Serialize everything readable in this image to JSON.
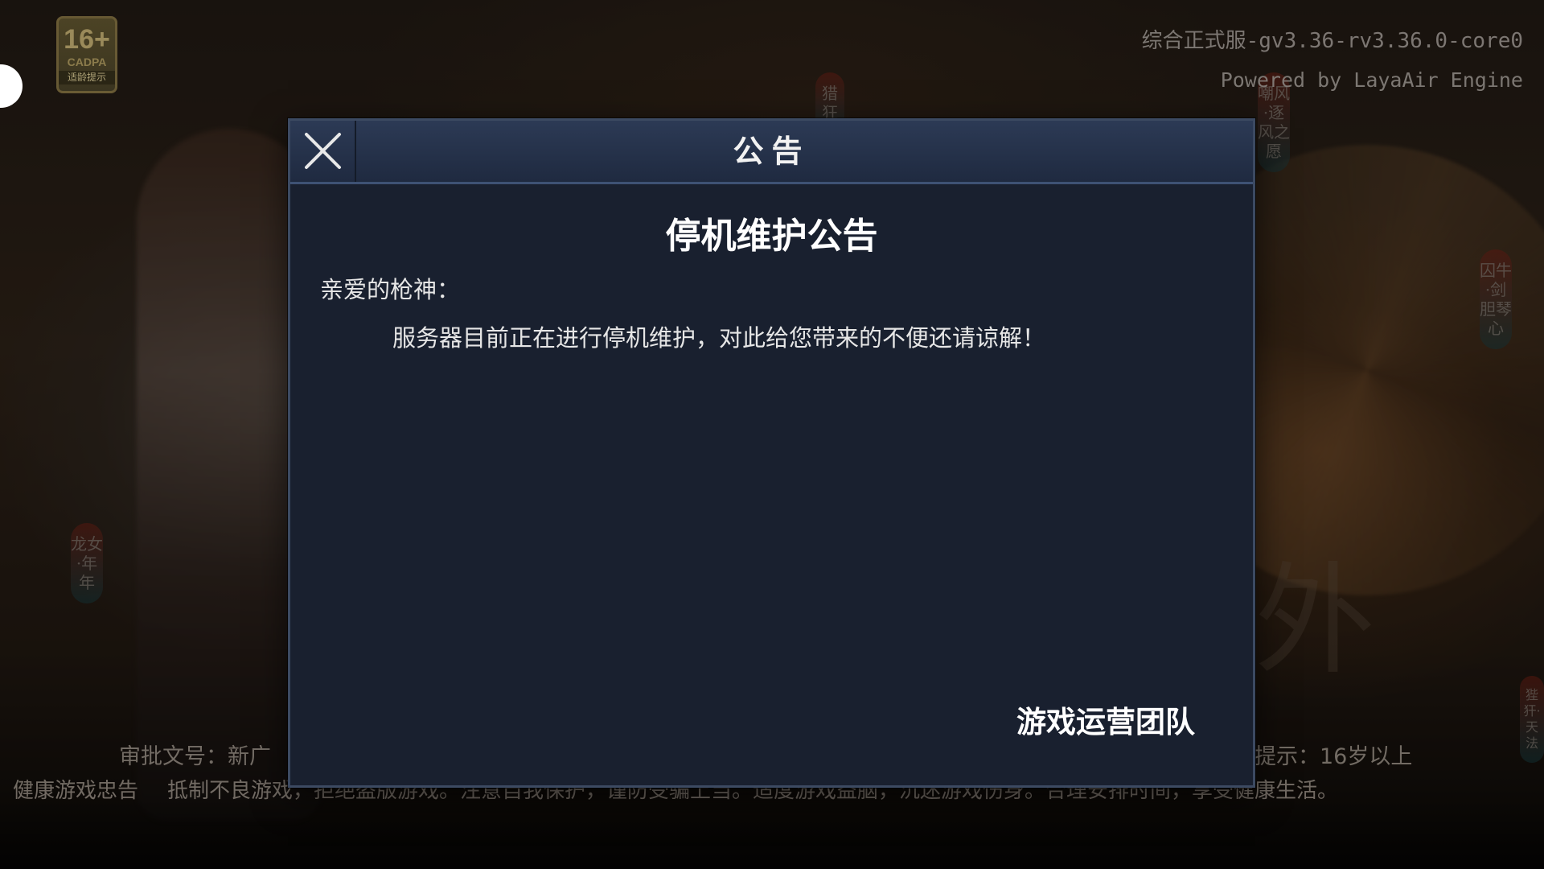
{
  "age_rating": {
    "age": "16+",
    "org": "CADPA",
    "tip": "适龄提示"
  },
  "version": {
    "build": "综合正式服-gv3.36-rv3.36.0-core0",
    "engine": "Powered by LayaAir Engine"
  },
  "banners": {
    "left": "龙女·年年",
    "top_center": "猎狂",
    "right_top": "嘲风·逐风之愿",
    "right_mid": "囚牛·剑胆琴心",
    "right_bottom": "狴犴·天法"
  },
  "footer": {
    "approval": "审批文号：新广",
    "age_hint": "提示：16岁以上",
    "advice_title": "健康游戏忠告",
    "advice_text": "抵制不良游戏，拒绝盗版游戏。注意自我保护，谨防受骗上当。适度游戏益脑，沉迷游戏伤身。合理安排时间，享受健康生活。"
  },
  "dialog": {
    "title": "公告",
    "heading": "停机维护公告",
    "greeting": "亲爱的枪神：",
    "body": "服务器目前正在进行停机维护，对此给您带来的不便还请谅解！",
    "signature": "游戏运营团队"
  },
  "colors": {
    "dialog_bg": "#19202f",
    "header_bg": "#2c3a55",
    "dialog_border": "#3c4a62"
  }
}
